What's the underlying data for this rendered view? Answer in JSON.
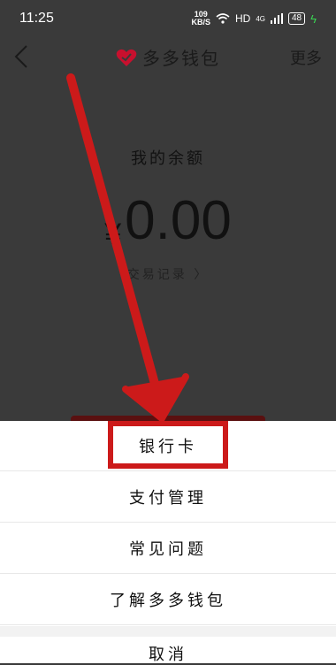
{
  "status": {
    "time": "11:25",
    "speed_value": "109",
    "speed_unit": "KB/S",
    "network": "HD",
    "signal": "4G",
    "battery": "48"
  },
  "nav": {
    "title": "多多钱包",
    "more": "更多"
  },
  "balance": {
    "label": "我的余额",
    "currency": "¥",
    "value": "0.00",
    "history_link": "交易记录 〉"
  },
  "sheet": {
    "items": [
      "银行卡",
      "支付管理",
      "常见问题",
      "了解多多钱包"
    ],
    "cancel": "取消"
  },
  "colors": {
    "overlay": "#3a3a3a",
    "annotation_red": "#cc1a1a",
    "brand_red": "#c8102e"
  },
  "icons": {
    "back": "chevron-left-icon",
    "brand": "heart-check-icon"
  }
}
